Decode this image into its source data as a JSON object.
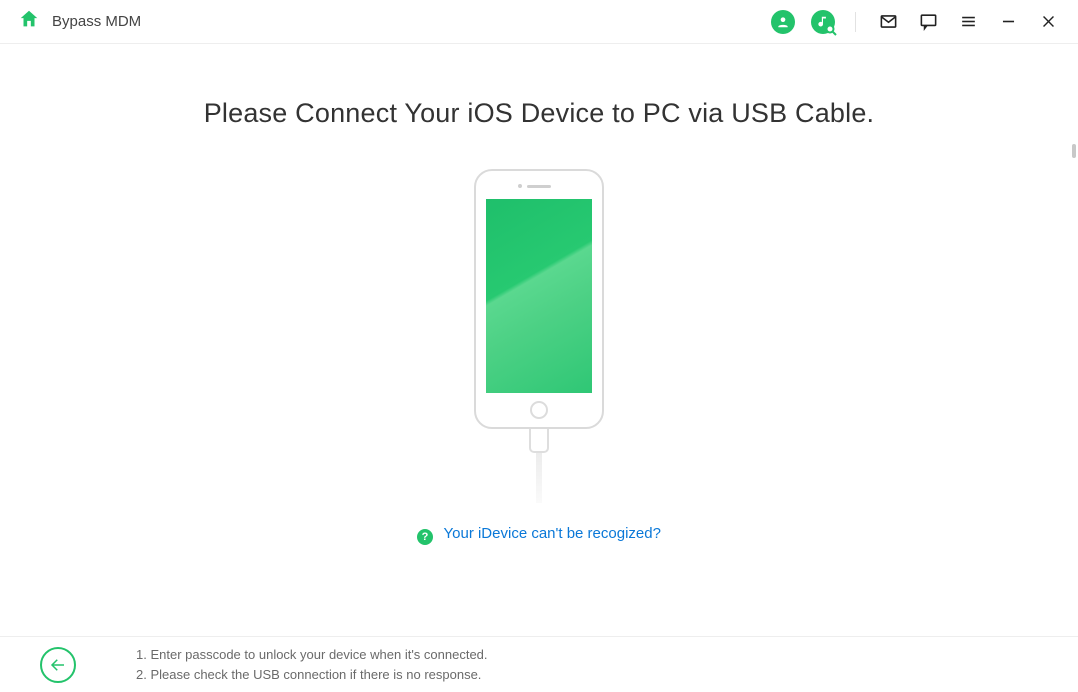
{
  "header": {
    "title": "Bypass MDM"
  },
  "main": {
    "headline": "Please Connect Your iOS Device to PC via USB Cable.",
    "help_link": "Your iDevice can't be recogized?"
  },
  "footer": {
    "tip1": "1. Enter passcode to unlock your device when it's connected.",
    "tip2": "2. Please check the USB connection if there is no response."
  },
  "colors": {
    "accent": "#23c36b",
    "link": "#0a78d8"
  }
}
